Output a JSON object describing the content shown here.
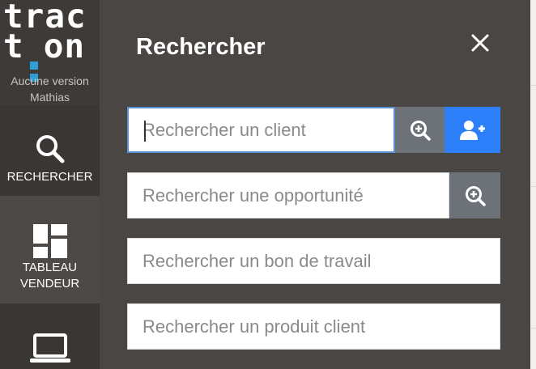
{
  "sidebar": {
    "logo_line1": "trac",
    "logo_line2_left": "t",
    "logo_line2_right": "on",
    "version_line1": "Aucune version",
    "version_line2": "Mathias",
    "items": [
      {
        "label": "RECHERCHER",
        "icon": "search-icon"
      },
      {
        "label_line1": "TABLEAU",
        "label_line2": "VENDEUR",
        "icon": "dashboard-icon"
      },
      {
        "label": "",
        "icon": "laptop-icon"
      }
    ]
  },
  "panel": {
    "title": "Rechercher",
    "close_icon": "close-icon",
    "search_client": {
      "placeholder": "Rechercher un client",
      "value": ""
    },
    "search_opportunity": {
      "placeholder": "Rechercher une opportunité",
      "value": ""
    },
    "search_work_order": {
      "placeholder": "Rechercher un bon de travail",
      "value": ""
    },
    "search_customer_product": {
      "placeholder": "Rechercher un produit client",
      "value": ""
    }
  },
  "colors": {
    "sidebar": "#3a3634",
    "panel": "#4a4644",
    "accent_blue": "#2d7ff9",
    "button_grey": "#6d7278",
    "logo_accent": "#2f9fd8"
  }
}
